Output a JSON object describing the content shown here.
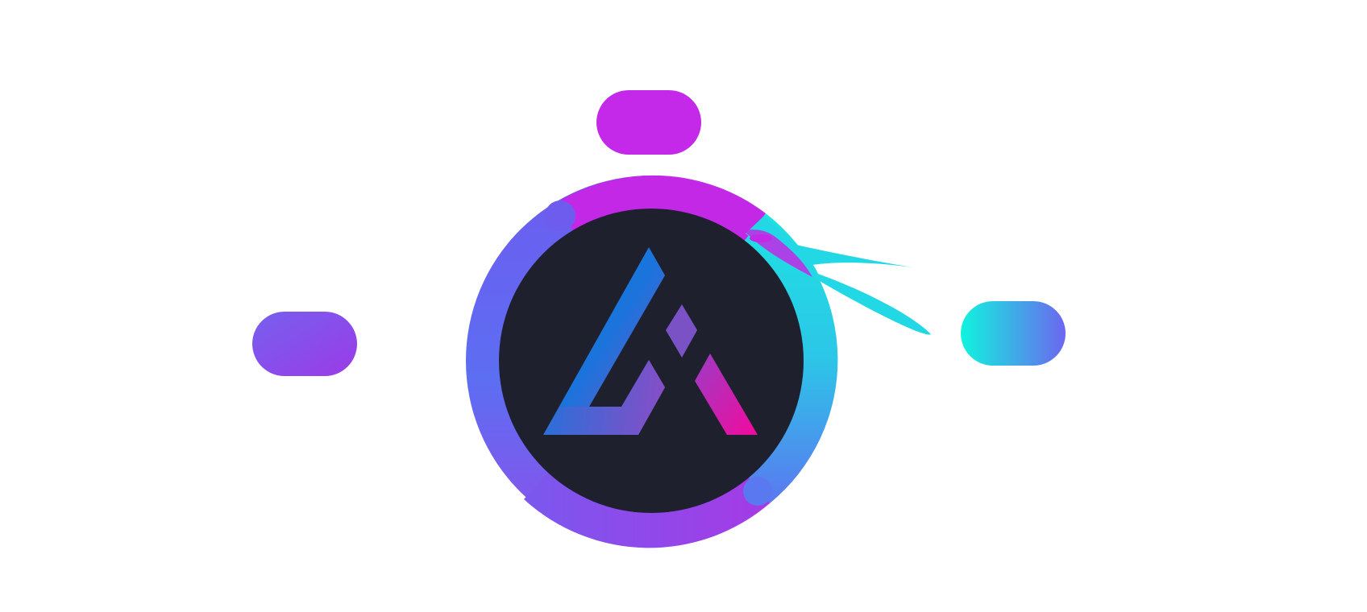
{
  "logo": {
    "icon": "triangle-a-monogram-icon"
  },
  "decorations": {
    "top_pill": {
      "icon": "pill-shape",
      "color": "#C228E8"
    },
    "left_pill": {
      "icon": "pill-shape",
      "color_start": "#7B5CEF",
      "color_end": "#9A3DE8"
    },
    "right_pill": {
      "icon": "pill-shape",
      "color_start": "#14F0E0",
      "color_end": "#6A6CF0"
    },
    "swoosh": {
      "icon": "swoosh-icon",
      "color": "#22D8E4"
    }
  },
  "colors": {
    "background": "#FFFFFF",
    "inner_disc": "#1F202D",
    "ring_magenta": "#C428E6",
    "ring_indigo": "#6B5FF0",
    "ring_cyan": "#24D6E6",
    "ring_blue": "#4F82F0",
    "mark_blue": "#0A7BE0",
    "mark_violet": "#7D4FC8",
    "mark_pink": "#E0159E"
  }
}
